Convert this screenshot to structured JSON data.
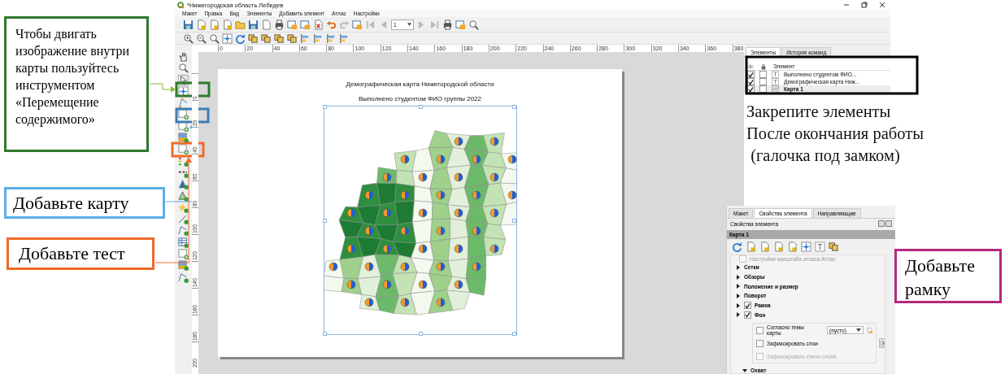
{
  "window": {
    "title": "*Нижегородская область Лебедев"
  },
  "menu": [
    "Макет",
    "Правка",
    "Вид",
    "Элементы",
    "Добавить элемент",
    "Атлас",
    "Настройки"
  ],
  "toolbar": {
    "page_number": "1"
  },
  "ruler_horizontal": [
    "0",
    "20",
    "40",
    "60",
    "80",
    "100",
    "120",
    "140",
    "160",
    "180",
    "200",
    "220",
    "240",
    "260",
    "280",
    "300",
    "320",
    "340",
    "360",
    "380"
  ],
  "ruler_vertical": [
    "0",
    "20",
    "40",
    "60",
    "80",
    "100",
    "120",
    "140",
    "160",
    "180",
    "200"
  ],
  "layout": {
    "title": "Демографическая карта Нижегородской области",
    "subtitle": "Выполнено студентом ФИО группы 2022",
    "map_selected": true
  },
  "elements_panel": {
    "tabs": [
      {
        "label": "Элементы",
        "selected": true
      },
      {
        "label": "История команд",
        "selected": false
      }
    ],
    "header": "Элемент",
    "items": [
      {
        "name": "Выполнено студентом ФИО...",
        "kind": "label",
        "visible": true,
        "locked": false,
        "selected": false
      },
      {
        "name": "Демографическая карта Ниж...",
        "kind": "label",
        "visible": true,
        "locked": false,
        "selected": false
      },
      {
        "name": "Карта 1",
        "kind": "map",
        "visible": true,
        "locked": false,
        "selected": true
      }
    ]
  },
  "lock_note": [
    "Закрепите элементы",
    "После окончания работы",
    " (галочка под замком)"
  ],
  "properties_panel": {
    "tabs": [
      {
        "label": "Макет",
        "selected": false
      },
      {
        "label": "Свойства элемента",
        "selected": true
      },
      {
        "label": "Направляющие",
        "selected": false
      }
    ],
    "title": "Свойства элемента",
    "item": "Карта 1",
    "partial_row": {
      "label": "Настройки масштаба атласа Атлас",
      "checked": false,
      "disabled": true
    },
    "sections": [
      {
        "label": "Сетки",
        "kind": "plain",
        "expanded": false
      },
      {
        "label": "Обзоры",
        "kind": "plain",
        "expanded": false
      },
      {
        "label": "Положение и размер",
        "kind": "plain",
        "expanded": false
      },
      {
        "label": "Поворот",
        "kind": "plain",
        "expanded": false
      },
      {
        "label": "Рамка",
        "kind": "checkbox",
        "checked": true,
        "expanded": false
      },
      {
        "label": "Фон",
        "kind": "checkbox",
        "checked": true,
        "expanded": false
      }
    ],
    "layer_options": [
      {
        "label": "Согласно темы карты",
        "kind": "dropdown",
        "checked": false,
        "disabled": false,
        "value": "(пусто)"
      },
      {
        "label": "Зафиксировать слои",
        "kind": "button",
        "checked": false,
        "disabled": false
      },
      {
        "label": "Зафиксировать стили слоев",
        "kind": "plain",
        "checked": false,
        "disabled": true
      }
    ],
    "extent": {
      "label": "Охват",
      "expanded": true
    }
  },
  "callouts": [
    {
      "text": "Чтобы двигать изображение внутри карты пользуйтесь инструментом «Перемещение содержимого»",
      "color": "#2e7a2e"
    },
    {
      "text": "Добавьте карту",
      "color": "#5aaee8"
    },
    {
      "text": "Добавьте тест",
      "color": "#f06a2a"
    },
    {
      "text": "Добавьте рамку",
      "color": "#b02a7a"
    }
  ]
}
